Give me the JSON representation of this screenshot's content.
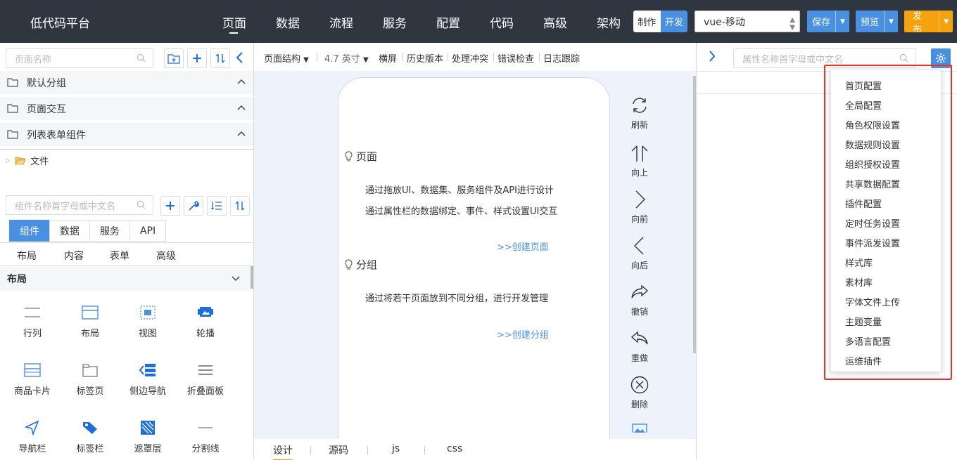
{
  "app": {
    "brand": "低代码平台"
  },
  "nav": {
    "items": [
      "页面",
      "数据",
      "流程",
      "服务",
      "配置",
      "代码",
      "高级",
      "架构"
    ],
    "active": "页面"
  },
  "mode": {
    "make": "制作",
    "dev": "开发"
  },
  "platform_select": {
    "value": "vue-移动"
  },
  "actions": {
    "save": "保存",
    "preview": "预览",
    "publish": "发布"
  },
  "colors": {
    "topbar": "#2f3640",
    "accent": "#4a90e2",
    "publish": "#f5a20e",
    "highlight": "#e5352b"
  },
  "left": {
    "page_search_placeholder": "页面名称",
    "groups": [
      "默认分组",
      "页面交互",
      "列表表单组件"
    ],
    "tree": {
      "folder": "文件"
    },
    "component_search_placeholder": "组件名称首字母或中文名",
    "tabs": [
      "组件",
      "数据",
      "服务",
      "API"
    ],
    "subtabs": [
      "布局",
      "内容",
      "表单",
      "高级"
    ],
    "section": "布局",
    "components": [
      "行列",
      "布局",
      "视图",
      "轮播",
      "商品卡片",
      "标签页",
      "侧边导航",
      "折叠面板",
      "导航栏",
      "标签栏",
      "遮罩层",
      "分割线"
    ]
  },
  "toolbar": {
    "structure": "页面结构",
    "size": "4.7 英寸",
    "landscape": "横屏",
    "history": "历史版本",
    "conflict": "处理冲突",
    "check": "错误检查",
    "log": "日志跟踪"
  },
  "canvas": {
    "page_title": "页面",
    "page_line1": "通过拖放UI、数据集、服务组件及API进行设计",
    "page_line2": "通过属性栏的数据绑定、事件、样式设置UI交互",
    "create_page": ">>创建页面",
    "group_title": "分组",
    "group_line1": "通过将若干页面放到不同分组，进行开发管理",
    "create_group": ">>创建分组"
  },
  "side_tools": [
    "刷新",
    "向上",
    "向前",
    "向后",
    "撤销",
    "重做",
    "删除"
  ],
  "bottom_tabs": {
    "items": [
      "设计",
      "源码",
      "js",
      "css"
    ],
    "active": "设计"
  },
  "right": {
    "search_placeholder": "属性名称首字母或中文名",
    "menu": [
      "首页配置",
      "全局配置",
      "角色权限设置",
      "数据规则设置",
      "组织授权设置",
      "共享数据配置",
      "插件配置",
      "定时任务设置",
      "事件派发设置",
      "样式库",
      "素材库",
      "字体文件上传",
      "主题变量",
      "多语言配置",
      "运维插件"
    ]
  }
}
